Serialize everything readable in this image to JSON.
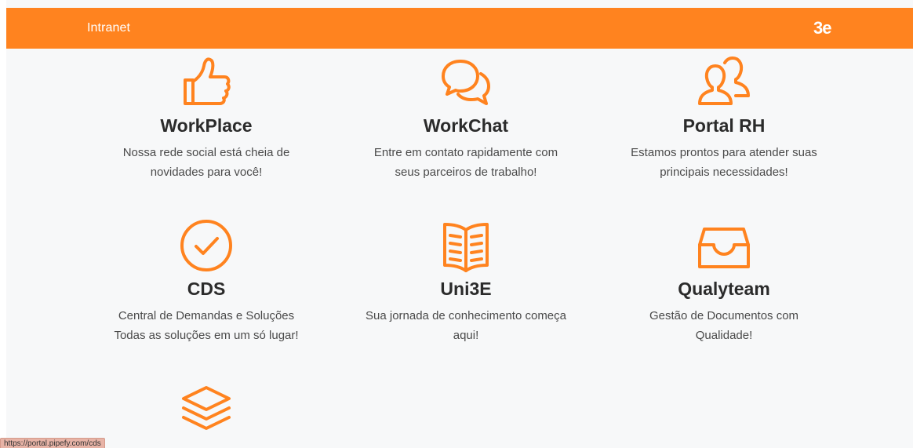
{
  "header": {
    "title": "Intranet",
    "logo_text": "3e"
  },
  "cards": [
    {
      "title": "WorkPlace",
      "description": "Nossa rede social está cheia de\nnovidades para você!",
      "icon": "thumbs-up-icon"
    },
    {
      "title": "WorkChat",
      "description": "Entre em contato rapidamente com\nseus parceiros de trabalho!",
      "icon": "chat-bubbles-icon"
    },
    {
      "title": "Portal RH",
      "description": "Estamos prontos para atender suas\nprincipais necessidades!",
      "icon": "users-icon"
    },
    {
      "title": "CDS",
      "description": "Central de Demandas e Soluções\nTodas as soluções em um só lugar!",
      "icon": "check-circle-icon"
    },
    {
      "title": "Uni3E",
      "description": "Sua jornada de conhecimento começa\naqui!",
      "icon": "open-book-icon"
    },
    {
      "title": "Qualyteam",
      "description": "Gestão de Documentos com\nQualidade!",
      "icon": "inbox-tray-icon"
    },
    {
      "title": "",
      "description": "",
      "icon": "layers-icon"
    }
  ],
  "status_bar": {
    "url": "https://portal.pipefy.com/cds"
  },
  "colors": {
    "accent": "#ff831f",
    "title": "#2b2b2b",
    "text": "#4a4a4a",
    "background": "#f7f8f9"
  }
}
